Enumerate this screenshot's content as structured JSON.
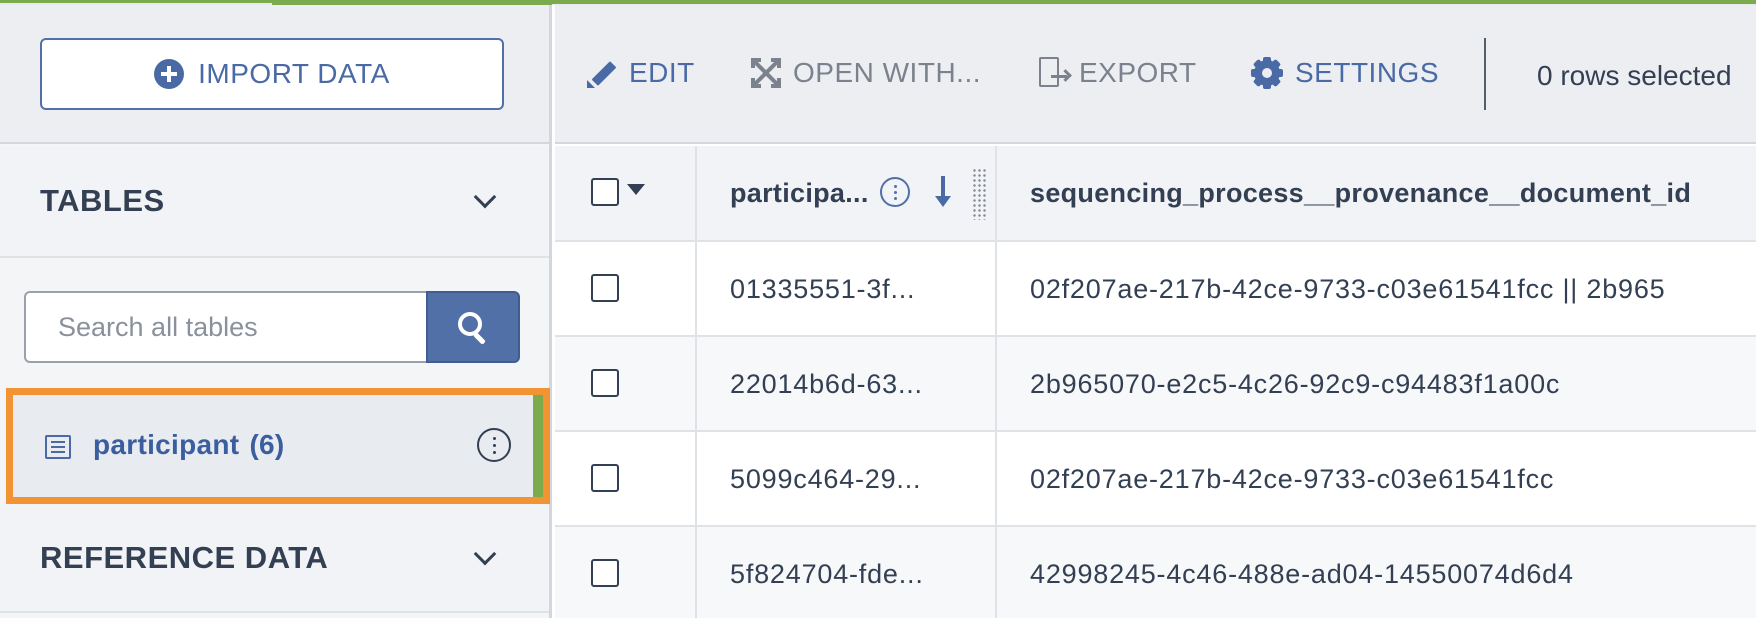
{
  "sidebar": {
    "import_label": "IMPORT DATA",
    "tables_heading": "TABLES",
    "search": {
      "placeholder": "Search all tables",
      "value": ""
    },
    "tables": [
      {
        "name": "participant",
        "count": "(6)",
        "selected": true
      }
    ],
    "reference_heading": "REFERENCE DATA"
  },
  "toolbar": {
    "edit_label": "EDIT",
    "open_with_label": "OPEN WITH...",
    "export_label": "EXPORT",
    "settings_label": "SETTINGS",
    "rows_selected": "0 rows selected"
  },
  "grid": {
    "columns": [
      {
        "header": "participa...",
        "sorted": "descending"
      },
      {
        "header": "sequencing_process__provenance__document_id"
      }
    ],
    "rows": [
      {
        "participant": "01335551-3f...",
        "doc_id": "02f207ae-217b-42ce-9733-c03e61541fcc || 2b965"
      },
      {
        "participant": "22014b6d-63...",
        "doc_id": "2b965070-e2c5-4c26-92c9-c94483f1a00c"
      },
      {
        "participant": "5099c464-29...",
        "doc_id": "02f207ae-217b-42ce-9733-c03e61541fcc"
      },
      {
        "participant": "5f824704-fde...",
        "doc_id": "42998245-4c46-488e-ad04-14550074d6d4"
      }
    ]
  },
  "colors": {
    "accent_blue": "#4a6aa5",
    "selection_orange": "#f39434",
    "progress_green": "#7cab4d"
  }
}
